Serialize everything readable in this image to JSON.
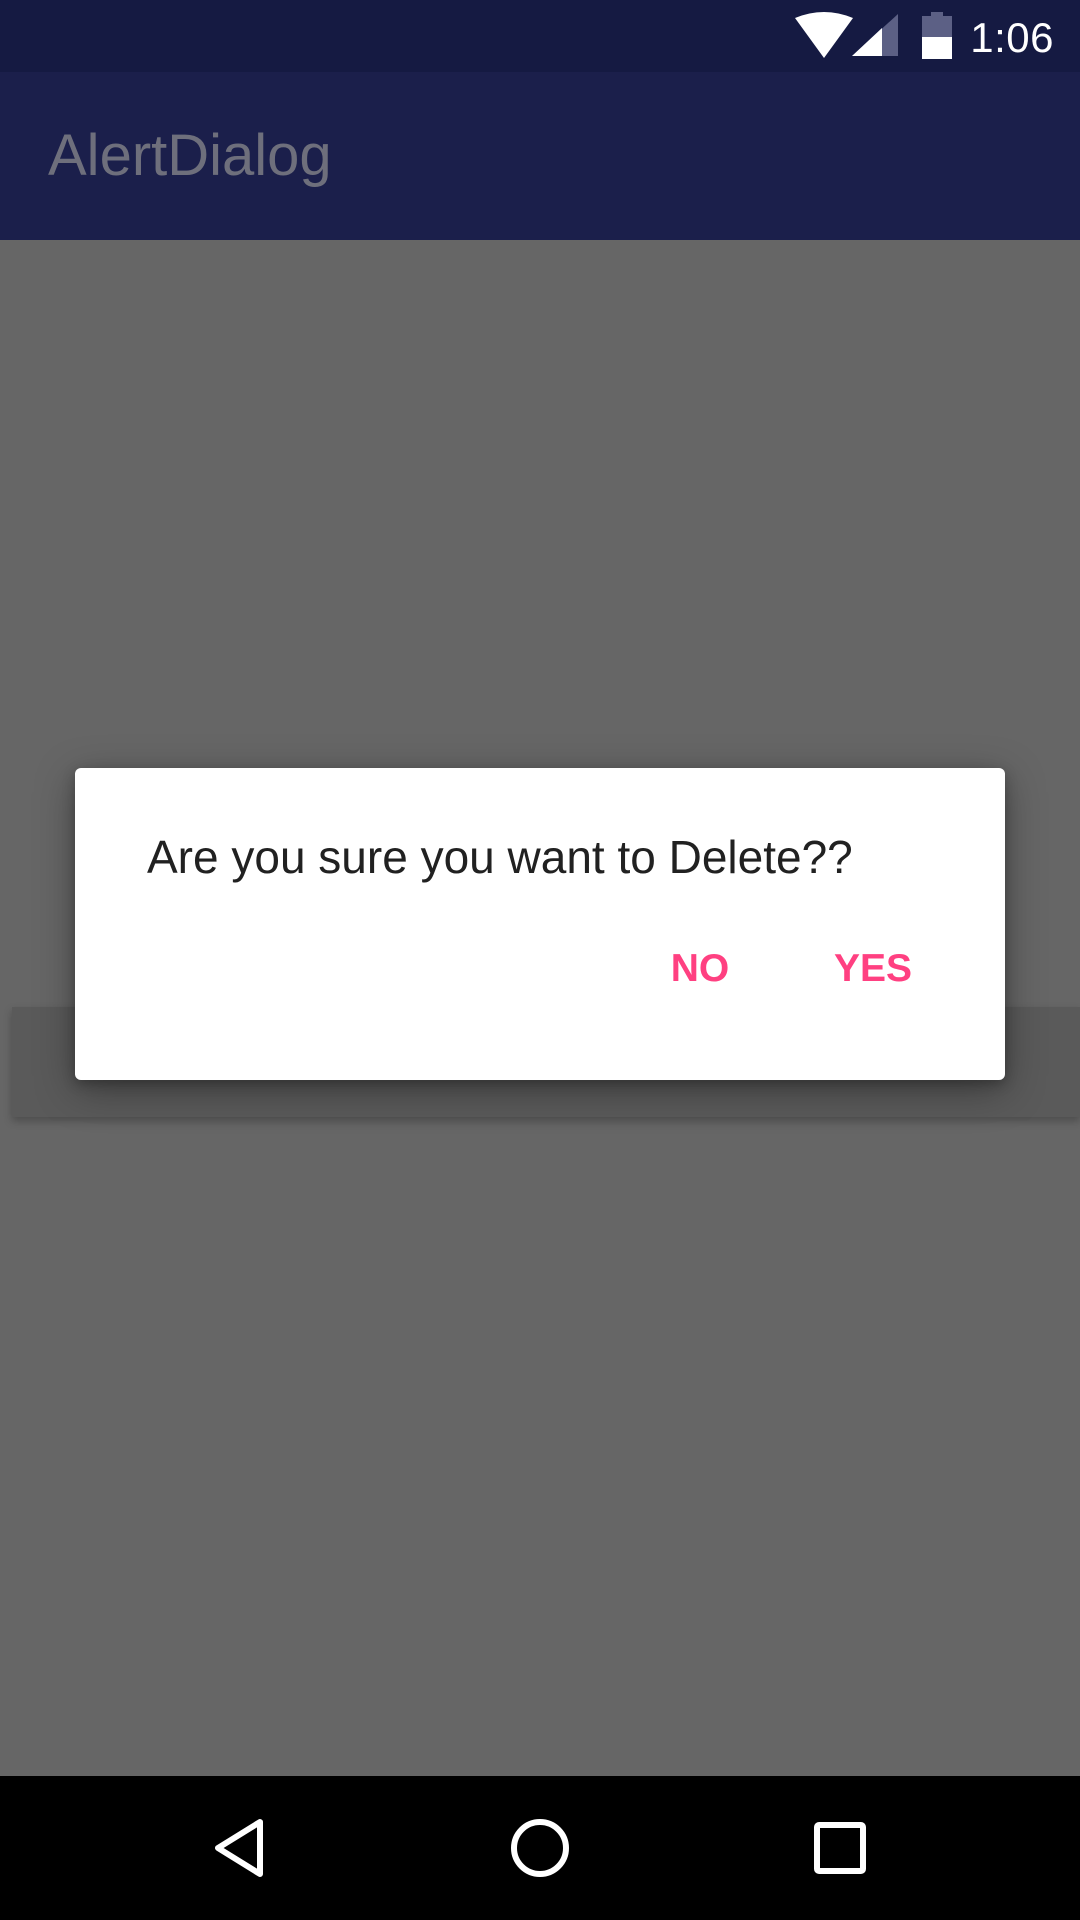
{
  "status_bar": {
    "time": "1:06",
    "icons": [
      "wifi-icon",
      "cell-signal-icon",
      "battery-icon"
    ]
  },
  "app_bar": {
    "title": "AlertDialog"
  },
  "dialog": {
    "message": "Are you sure you want to Delete??",
    "negative_label": "NO",
    "positive_label": "YES",
    "accent_color": "#ff4081"
  },
  "nav_bar": {
    "icons": [
      "back-icon",
      "home-icon",
      "recents-icon"
    ]
  },
  "colors": {
    "status_bar": "#151a42",
    "app_bar": "#1b1f4b",
    "scrim_background": "#666666",
    "dialog_background": "#ffffff",
    "nav_bar": "#000000"
  }
}
